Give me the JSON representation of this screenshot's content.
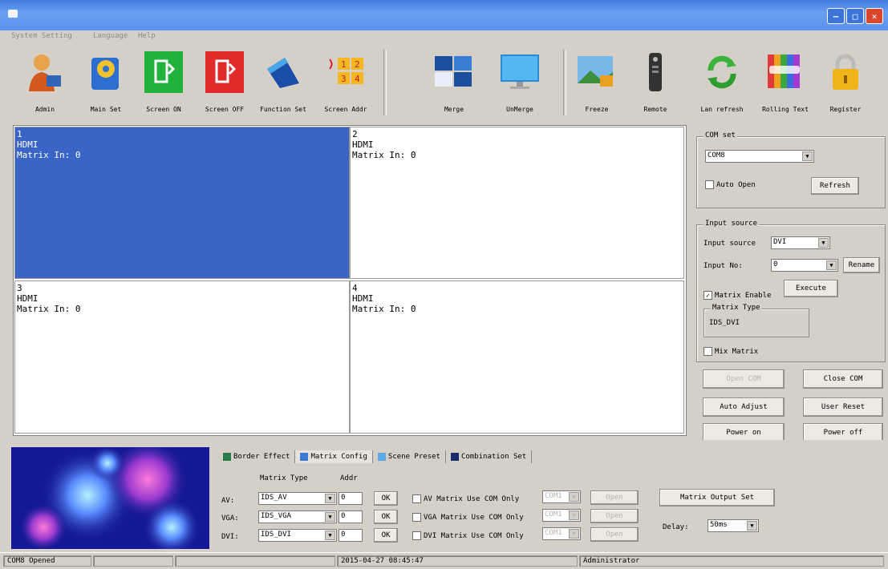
{
  "menu": [
    "System Setting",
    "Language",
    "Help"
  ],
  "toolbar": [
    {
      "label": "Admin",
      "icon": "admin-icon"
    },
    {
      "label": "Main Set",
      "icon": "main-set-icon"
    },
    {
      "label": "Screen ON",
      "icon": "screen-on-icon"
    },
    {
      "label": "Screen OFF",
      "icon": "screen-off-icon"
    },
    {
      "label": "Function Set",
      "icon": "function-set-icon"
    },
    {
      "label": "Screen Addr",
      "icon": "screen-addr-icon"
    },
    {
      "label": "Merge",
      "icon": "merge-icon"
    },
    {
      "label": "UnMerge",
      "icon": "unmerge-icon"
    },
    {
      "label": "Freeze",
      "icon": "freeze-icon"
    },
    {
      "label": "Remote",
      "icon": "remote-icon"
    },
    {
      "label": "Lan refresh",
      "icon": "lan-refresh-icon"
    },
    {
      "label": "Rolling Text",
      "icon": "rolling-text-icon"
    },
    {
      "label": "Register",
      "icon": "register-icon"
    }
  ],
  "screens": [
    {
      "num": "1",
      "source": "HDMI",
      "matrix": "Matrix In: 0"
    },
    {
      "num": "2",
      "source": "HDMI",
      "matrix": "Matrix In: 0"
    },
    {
      "num": "3",
      "source": "HDMI",
      "matrix": "Matrix In: 0"
    },
    {
      "num": "4",
      "source": "HDMI",
      "matrix": "Matrix In: 0"
    }
  ],
  "com_set": {
    "title": "COM set",
    "port": "COM8",
    "auto_open": "Auto Open",
    "refresh": "Refresh"
  },
  "input_source": {
    "title": "Input source",
    "source_label": "Input source",
    "source_value": "DVI",
    "no_label": "Input No:",
    "no_value": "0",
    "rename": "Rename",
    "matrix_enable": "Matrix Enable",
    "execute": "Execute",
    "matrix_type_title": "Matrix Type",
    "matrix_type_value": "IDS_DVI",
    "mix_matrix": "Mix Matrix"
  },
  "actions": {
    "open_com": "Open COM",
    "close_com": "Close COM",
    "auto_adjust": "Auto Adjust",
    "user_reset": "User Reset",
    "power_on": "Power on",
    "power_off": "Power off"
  },
  "tabs": [
    "Border Effect",
    "Matrix Config",
    "Scene Preset",
    "Combination Set"
  ],
  "matrix_config": {
    "type_header": "Matrix Type",
    "addr_header": "Addr",
    "rows": [
      {
        "label": "AV:",
        "type": "IDS_AV",
        "addr": "0",
        "ok": "OK",
        "chk": "AV Matrix Use COM Only",
        "com": "COM1",
        "open": "Open"
      },
      {
        "label": "VGA:",
        "type": "IDS_VGA",
        "addr": "0",
        "ok": "OK",
        "chk": "VGA Matrix Use COM Only",
        "com": "COM1",
        "open": "Open"
      },
      {
        "label": "DVI:",
        "type": "IDS_DVI",
        "addr": "0",
        "ok": "OK",
        "chk": "DVI Matrix Use COM Only",
        "com": "COM1",
        "open": "Open"
      }
    ],
    "output_set": "Matrix Output Set",
    "delay_label": "Delay:",
    "delay_value": "50ms"
  },
  "status": {
    "port": "COM8 Opened",
    "datetime": "2015-04-27 08:45:47",
    "user": "Administrator"
  }
}
